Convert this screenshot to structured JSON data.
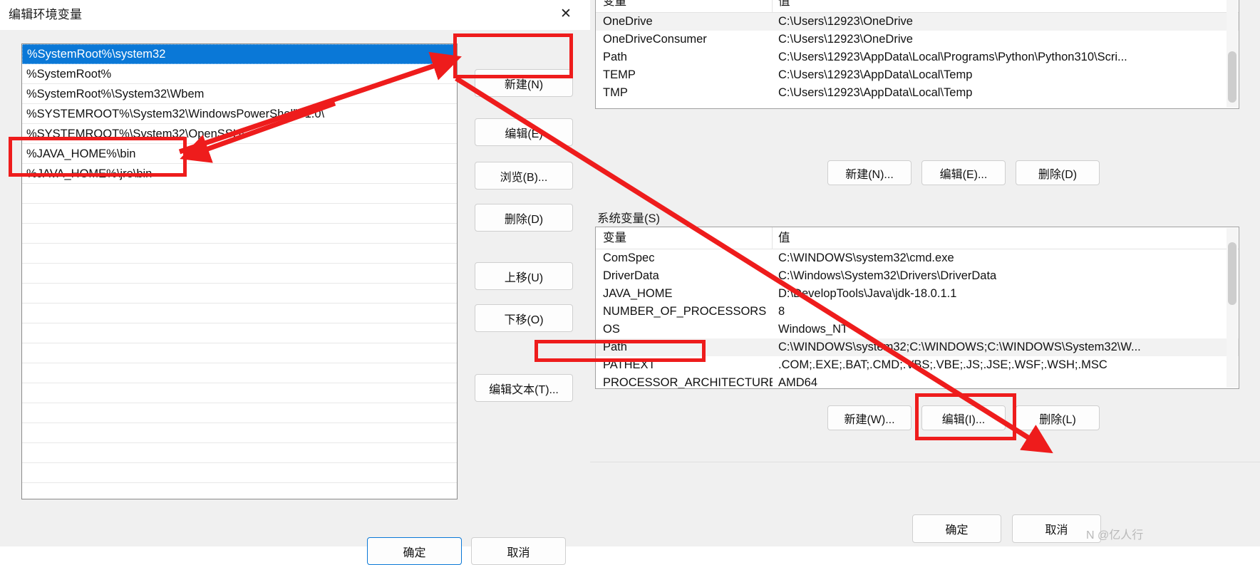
{
  "edit_dialog": {
    "title": "编辑环境变量",
    "close_icon": "close-icon",
    "path_entries": [
      "%SystemRoot%\\system32",
      "%SystemRoot%",
      "%SystemRoot%\\System32\\Wbem",
      "%SYSTEMROOT%\\System32\\WindowsPowerShell\\v1.0\\",
      "%SYSTEMROOT%\\System32\\OpenSSH\\",
      "%JAVA_HOME%\\bin",
      "%JAVA_HOME%\\jre\\bin"
    ],
    "selected_index": 0,
    "buttons": {
      "new": "新建(N)",
      "new_accel": "N",
      "edit": "编辑(E)",
      "edit_accel": "E",
      "browse": "浏览(B)...",
      "browse_accel": "B",
      "delete": "删除(D)",
      "delete_accel": "D",
      "move_up": "上移(U)",
      "move_up_accel": "U",
      "move_down": "下移(O)",
      "move_down_accel": "O",
      "edit_text": "编辑文本(T)...",
      "edit_text_accel": "T",
      "ok": "确定",
      "cancel": "取消"
    }
  },
  "env_dialog": {
    "user_table": {
      "headers": [
        "变量",
        "值"
      ],
      "rows": [
        [
          "OneDrive",
          "C:\\Users\\12923\\OneDrive"
        ],
        [
          "OneDriveConsumer",
          "C:\\Users\\12923\\OneDrive"
        ],
        [
          "Path",
          "C:\\Users\\12923\\AppData\\Local\\Programs\\Python\\Python310\\Scri..."
        ],
        [
          "TEMP",
          "C:\\Users\\12923\\AppData\\Local\\Temp"
        ],
        [
          "TMP",
          "C:\\Users\\12923\\AppData\\Local\\Temp"
        ]
      ]
    },
    "user_buttons": {
      "new": "新建(N)...",
      "edit": "编辑(E)...",
      "delete": "删除(D)"
    },
    "system_label": "系统变量(S)",
    "system_label_accel": "S",
    "system_table": {
      "headers": [
        "变量",
        "值"
      ],
      "rows": [
        [
          "ComSpec",
          "C:\\WINDOWS\\system32\\cmd.exe"
        ],
        [
          "DriverData",
          "C:\\Windows\\System32\\Drivers\\DriverData"
        ],
        [
          "JAVA_HOME",
          "D:\\DevelopTools\\Java\\jdk-18.0.1.1"
        ],
        [
          "NUMBER_OF_PROCESSORS",
          "8"
        ],
        [
          "OS",
          "Windows_NT"
        ],
        [
          "Path",
          "C:\\WINDOWS\\system32;C:\\WINDOWS;C:\\WINDOWS\\System32\\W..."
        ],
        [
          "PATHEXT",
          ".COM;.EXE;.BAT;.CMD;.VBS;.VBE;.JS;.JSE;.WSF;.WSH;.MSC"
        ],
        [
          "PROCESSOR_ARCHITECTURE",
          "AMD64"
        ]
      ],
      "selected_row_index": 5
    },
    "system_buttons": {
      "new": "新建(W)...",
      "edit": "编辑(I)...",
      "delete": "删除(L)"
    },
    "ok": "确定",
    "cancel": "取消",
    "watermark": "N @亿人行"
  },
  "annotations": {
    "highlight_color": "#ee1c1c",
    "boxes": [
      "new-button-highlight",
      "java-home-entries-highlight",
      "system-path-row-highlight",
      "system-edit-button-highlight"
    ],
    "arrows": [
      "arrow-to-new-button",
      "arrow-to-java-entries",
      "arrow-to-system-edit-button"
    ]
  }
}
